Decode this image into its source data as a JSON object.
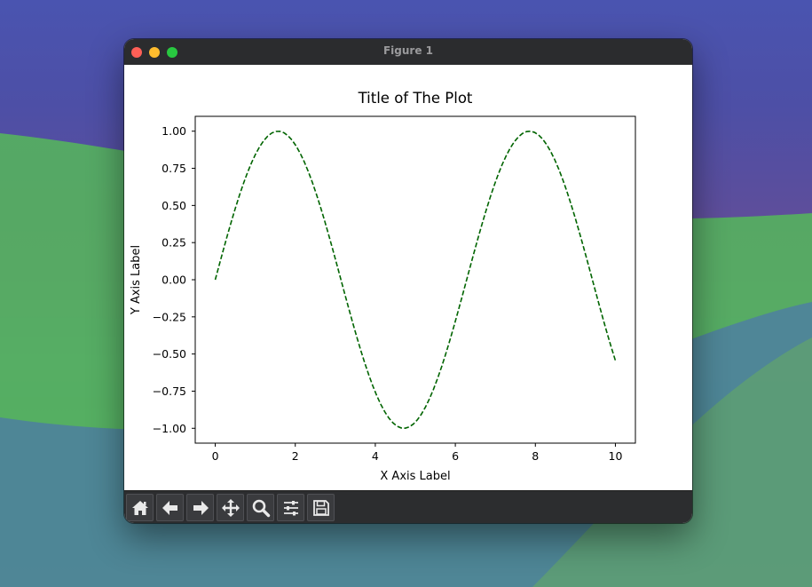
{
  "window": {
    "title": "Figure 1"
  },
  "toolbar": {
    "buttons": [
      {
        "name": "home-icon"
      },
      {
        "name": "back-arrow-icon"
      },
      {
        "name": "forward-arrow-icon"
      },
      {
        "name": "pan-move-icon"
      },
      {
        "name": "zoom-magnifier-icon"
      },
      {
        "name": "configure-subplots-icon"
      },
      {
        "name": "save-floppy-icon"
      }
    ]
  },
  "chart_data": {
    "type": "line",
    "title": "Title of The Plot",
    "xlabel": "X Axis Label",
    "ylabel": "Y Axis Label",
    "xlim": [
      -0.5,
      10.5
    ],
    "ylim": [
      -1.1,
      1.1
    ],
    "xticks": [
      0,
      2,
      4,
      6,
      8,
      10
    ],
    "xtick_labels": [
      "0",
      "2",
      "4",
      "6",
      "8",
      "10"
    ],
    "yticks": [
      1.0,
      0.75,
      0.5,
      0.25,
      0.0,
      -0.25,
      -0.5,
      -0.75,
      -1.0
    ],
    "ytick_labels": [
      "1.00",
      "0.75",
      "0.50",
      "0.25",
      "0.00",
      "−0.25",
      "−0.50",
      "−0.75",
      "−1.00"
    ],
    "grid": false,
    "series": [
      {
        "function": "sin(x)",
        "x_range": [
          0,
          10
        ],
        "points": 100,
        "color": "#006400",
        "linestyle": "dashed"
      }
    ]
  }
}
